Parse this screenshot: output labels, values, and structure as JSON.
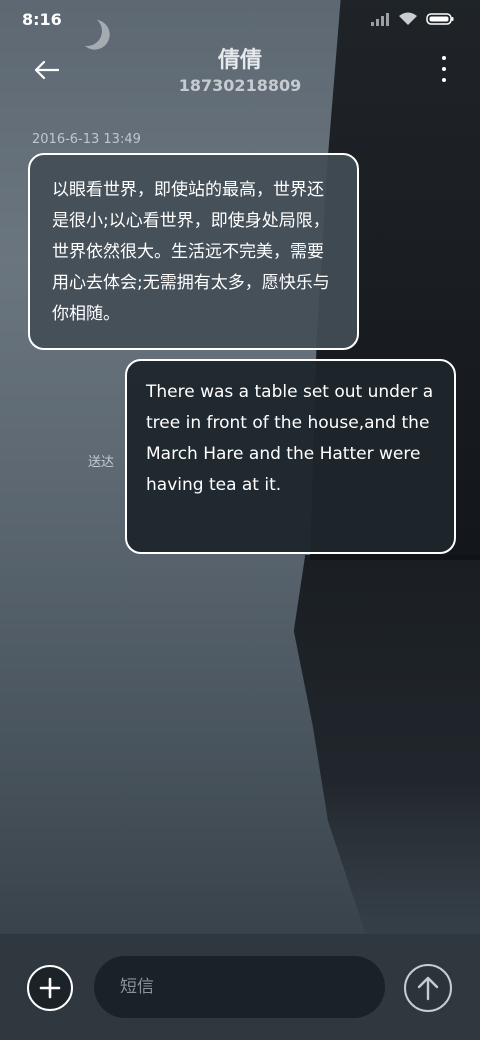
{
  "status_bar": {
    "time": "8:16",
    "icons": [
      "signal-icon",
      "wifi-icon",
      "battery-icon"
    ]
  },
  "header": {
    "back_icon": "arrow-left-icon",
    "contact_name": "倩倩",
    "phone_number": "18730218809",
    "menu_icon": "more-vertical-icon"
  },
  "conversation": {
    "timestamp": "2016-6-13 13:49",
    "messages": [
      {
        "direction": "incoming",
        "text": "以眼看世界，即使站的最高，世界还是很小;以心看世界，即使身处局限，世界依然很大。生活远不完美，需要用心去体会;无需拥有太多，愿快乐与你相随。"
      },
      {
        "direction": "outgoing",
        "text": "There was a table set out under a tree in front of the house,and the March Hare and the Hatter were having tea at it.",
        "status": "送达"
      }
    ]
  },
  "composer": {
    "add_icon": "plus-icon",
    "placeholder": "短信",
    "value": "",
    "send_icon": "arrow-up-icon"
  },
  "colors": {
    "bubble_border": "#ffffff",
    "incoming_bubble": "#424d56",
    "outgoing_bubble": "#1e262c",
    "input_bar": "#2e383e"
  }
}
